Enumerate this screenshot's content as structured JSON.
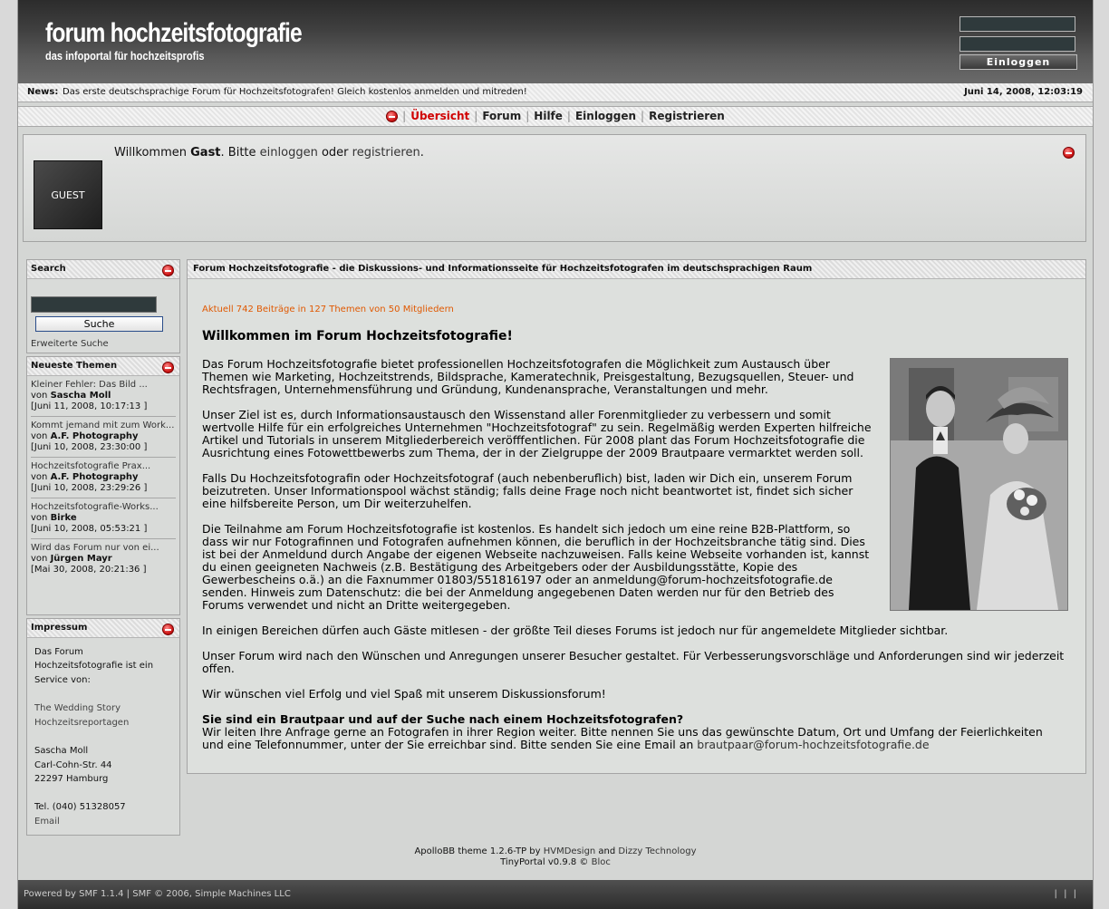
{
  "header": {
    "title": "forum hochzeitsfotografie",
    "subtitle": "das infoportal für hochzeitsprofis",
    "login_button": "Einloggen"
  },
  "news": {
    "label": "News:",
    "text": "Das erste deutschsprachige Forum für Hochzeitsfotografen! Gleich kostenlos anmelden und mitreden!",
    "datetime": "Juni 14, 2008, 12:03:19"
  },
  "menu": {
    "items": [
      "Übersicht",
      "Forum",
      "Hilfe",
      "Einloggen",
      "Registrieren"
    ],
    "separator": "|"
  },
  "welcome_box": {
    "avatar_label": "GUEST",
    "prefix": "Willkommen ",
    "user": "Gast",
    "mid1": ". Bitte ",
    "login_link": "einloggen",
    "mid2": " oder ",
    "register_link": "registrieren",
    "suffix": "."
  },
  "search_block": {
    "title": "Search",
    "button": "Suche",
    "advanced": "Erweiterte Suche"
  },
  "topics_block": {
    "title": "Neueste Themen",
    "by": "von ",
    "topics": [
      {
        "title": "Kleiner Fehler: Das Bild ...",
        "author": "Sascha Moll",
        "date": "[Juni 11, 2008, 10:17:13 ]"
      },
      {
        "title": "Kommt jemand mit zum Work...",
        "author": "A.F. Photography",
        "date": "[Juni 10, 2008, 23:30:00 ]"
      },
      {
        "title": "Hochzeitsfotografie Prax...",
        "author": "A.F. Photography",
        "date": "[Juni 10, 2008, 23:29:26 ]"
      },
      {
        "title": "Hochzeitsfotografie-Works...",
        "author": "Birke",
        "date": "[Juni 10, 2008, 05:53:21 ]"
      },
      {
        "title": "Wird das Forum nur von ei...",
        "author": "Jürgen Mayr",
        "date": "[Mai 30, 2008, 20:21:36 ]"
      }
    ]
  },
  "impressum_block": {
    "title": "Impressum",
    "intro1": "Das Forum",
    "intro2": "Hochzeitsfotografie ist ein",
    "intro3": "Service von:",
    "company1": "The Wedding Story",
    "company2": "Hochzeitsreportagen",
    "name": "Sascha Moll",
    "street": "Carl-Cohn-Str. 44",
    "city": "22297 Hamburg",
    "phone": "Tel. (040) 51328057",
    "email": "Email"
  },
  "main": {
    "header": "Forum Hochzeitsfotografie - die Diskussions- und Informationsseite für Hochzeitsfotografen im deutschsprachigen Raum",
    "stats": "Aktuell 742 Beiträge in 127 Themen von 50 Mitgliedern",
    "title": "Willkommen im Forum Hochzeitsfotografie!",
    "p1": "Das Forum Hochzeitsfotografie bietet professionellen Hochzeitsfotografen die Möglichkeit zum Austausch über Themen wie Marketing, Hochzeitstrends, Bildsprache, Kameratechnik, Preisgestaltung, Bezugsquellen, Steuer- und Rechtsfragen, Unternehmensführung und Gründung, Kundenansprache, Veranstaltungen und mehr.",
    "p2": "Unser Ziel ist es, durch Informationsaustausch den Wissenstand aller Forenmitglieder zu verbessern und somit wertvolle Hilfe für ein erfolgreiches Unternehmen \"Hochzeitsfotograf\" zu sein. Regelmäßig werden Experten hilfreiche Artikel und Tutorials in unserem Mitgliederbereich veröfffentlichen. Für 2008 plant das Forum Hochzeitsfotografie die Ausrichtung eines Fotowettbewerbs zum Thema, der in der Zielgruppe der 2009 Brautpaare vermarktet werden soll.",
    "p3": "Falls Du Hochzeitsfotografin oder Hochzeitsfotograf (auch nebenberuflich) bist, laden wir Dich ein, unserem Forum beizutreten. Unser Informationspool wächst ständig; falls deine Frage noch nicht beantwortet ist, findet sich sicher eine hilfsbereite Person, um Dir weiterzuhelfen.",
    "p4": "Die Teilnahme am Forum Hochzeitsfotografie ist kostenlos. Es handelt sich jedoch um eine reine B2B-Plattform, so dass wir nur Fotografinnen und Fotografen aufnehmen können, die beruflich in der Hochzeitsbranche tätig sind. Dies ist bei der Anmeldund durch Angabe der eigenen Webseite nachzuweisen. Falls keine Webseite vorhanden ist, kannst du einen geeigneten Nachweis (z.B. Bestätigung des Arbeitgebers oder der Ausbildungsstätte, Kopie des Gewerbescheins o.ä.) an die Faxnummer 01803/551816197 oder an anmeldung@forum-hochzeitsfotografie.de senden. Hinweis zum Datenschutz: die bei der Anmeldung angegebenen Daten werden nur für den Betrieb des Forums verwendet und nicht an Dritte weitergegeben.",
    "p5": "In einigen Bereichen dürfen auch Gäste mitlesen - der größte Teil dieses Forums ist jedoch nur für angemeldete Mitglieder sichtbar.",
    "p6": "Unser Forum wird nach den Wünschen und Anregungen unserer Besucher gestaltet. Für Verbesserungsvorschläge und Anforderungen sind wir jederzeit offen.",
    "p7": "Wir wünschen viel Erfolg und viel Spaß mit unserem Diskussionsforum!",
    "p8_title": "Sie sind ein Brautpaar und auf der Suche nach einem Hochzeitsfotografen?",
    "p8_text": "Wir leiten Ihre Anfrage gerne an Fotografen in ihrer Region weiter. Bitte nennen Sie uns das gewünschte Datum, Ort und Umfang der Feierlichkeiten und eine Telefonnummer, unter der Sie erreichbar sind. Bitte senden Sie eine Email an ",
    "p8_email": "brautpaar@forum-hochzeitsfotografie.de"
  },
  "credits": {
    "line1_a": "ApolloBB theme 1.2.6-TP by ",
    "line1_link1": "HVMDesign",
    "line1_b": " and ",
    "line1_link2": "Dizzy Technology",
    "line2_a": "TinyPortal v0.9.8 © ",
    "line2_link": "Bloc"
  },
  "footer": {
    "left": "Powered by SMF 1.1.4 | SMF © 2006, Simple Machines LLC",
    "right": "| | |"
  }
}
